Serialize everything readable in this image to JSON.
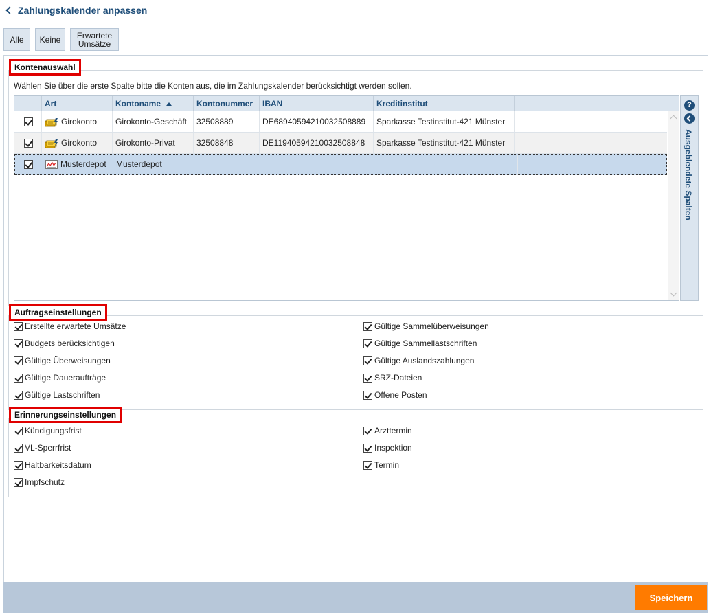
{
  "page": {
    "title": "Zahlungskalender anpassen"
  },
  "toolbar": {
    "all_label": "Alle",
    "none_label": "Keine",
    "expected_label_1": "Erwartete",
    "expected_label_2": "Umsätze"
  },
  "accounts": {
    "legend": "Kontenauswahl",
    "hint": "Wählen Sie über die erste Spalte bitte die Konten aus, die im Zahlungskalender berücksichtigt werden sollen.",
    "columns": [
      "Art",
      "Kontoname",
      "Kontonummer",
      "IBAN",
      "Kreditinstitut"
    ],
    "sort_column": "Kontoname",
    "rows": [
      {
        "checked": true,
        "type": "Girokonto",
        "icon": "bank-account-icon",
        "name": "Girokonto-Geschäft",
        "number": "32508889",
        "iban": "DE68940594210032508889",
        "bank": "Sparkasse Testinstitut-421 Münster"
      },
      {
        "checked": true,
        "type": "Girokonto",
        "icon": "bank-account-icon",
        "name": "Girokonto-Privat",
        "number": "32508848",
        "iban": "DE11940594210032508848",
        "bank": "Sparkasse Testinstitut-421 Münster"
      },
      {
        "checked": true,
        "type": "Musterdepot",
        "icon": "depot-chart-icon",
        "name": "Musterdepot",
        "number": "",
        "iban": "",
        "bank": ""
      }
    ],
    "side_panel": {
      "help": "?",
      "label": "Ausgeblendete Spalten"
    }
  },
  "orders": {
    "legend": "Auftragseinstellungen",
    "left": [
      {
        "label": "Erstellte erwartete Umsätze",
        "checked": true
      },
      {
        "label": "Budgets berücksichtigen",
        "checked": true
      },
      {
        "label": "Gültige Überweisungen",
        "checked": true
      },
      {
        "label": "Gültige Daueraufträge",
        "checked": true
      },
      {
        "label": "Gültige Lastschriften",
        "checked": true
      }
    ],
    "right": [
      {
        "label": "Gültige Sammelüberweisungen",
        "checked": true
      },
      {
        "label": "Gültige Sammellastschriften",
        "checked": true
      },
      {
        "label": "Gültige Auslandszahlungen",
        "checked": true
      },
      {
        "label": "SRZ-Dateien",
        "checked": true
      },
      {
        "label": "Offene Posten",
        "checked": true
      }
    ]
  },
  "reminders": {
    "legend": "Erinnerungseinstellungen",
    "left": [
      {
        "label": "Kündigungsfrist",
        "checked": true
      },
      {
        "label": "VL-Sperrfrist",
        "checked": true
      },
      {
        "label": "Haltbarkeitsdatum",
        "checked": true
      },
      {
        "label": "Impfschutz",
        "checked": true
      }
    ],
    "right": [
      {
        "label": "Arzttermin",
        "checked": true
      },
      {
        "label": "Inspektion",
        "checked": true
      },
      {
        "label": "Termin",
        "checked": true
      }
    ]
  },
  "footer": {
    "save_label": "Speichern"
  },
  "colors": {
    "accent": "#1f4e79",
    "save": "#ff7b00",
    "highlight": "#e00000",
    "selected_row": "#c7d9ec"
  }
}
